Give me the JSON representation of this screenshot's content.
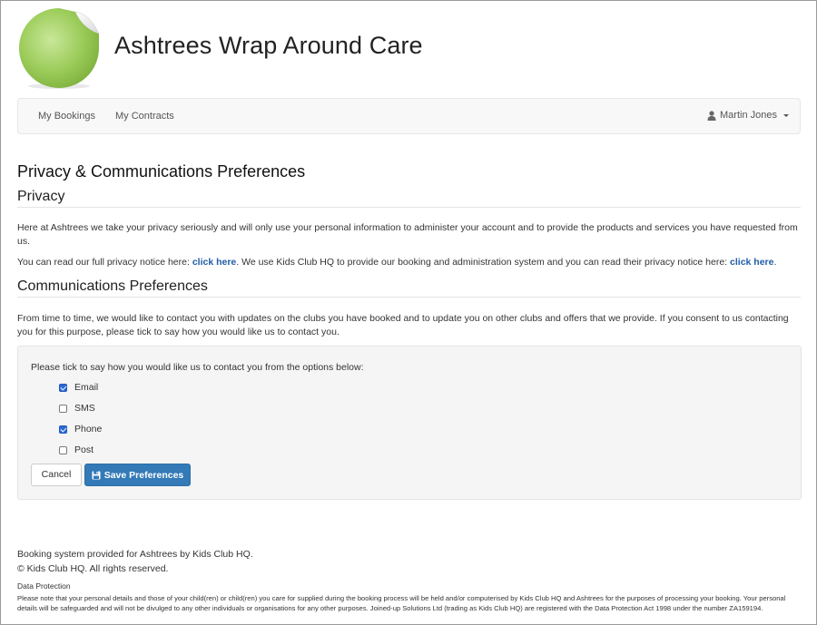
{
  "header": {
    "title": "Ashtrees Wrap Around Care",
    "logo_icon": "green-sticker-logo"
  },
  "nav": {
    "items": [
      {
        "label": "My Bookings"
      },
      {
        "label": "My Contracts"
      }
    ],
    "user": {
      "name": "Martin Jones",
      "icon": "user-icon"
    }
  },
  "page": {
    "title": "Privacy & Communications Preferences",
    "privacy": {
      "heading": "Privacy",
      "p1": "Here at Ashtrees we take your privacy seriously and will only use your personal information to administer your account and to provide the products and services you have requested from us.",
      "p2_prefix": "You can read our full privacy notice here: ",
      "p2_link1": "click here",
      "p2_middle": ". We use Kids Club HQ to provide our booking and administration system and you can read their privacy notice here: ",
      "p2_link2": "click here",
      "p2_suffix": "."
    },
    "comms": {
      "heading": "Communications Preferences",
      "p1": "From time to time, we would like to contact you with updates on the clubs you have booked and to update you on other clubs and offers that we provide. If you consent to us contacting you for this purpose, please tick to say how you would like us to contact you.",
      "prompt": "Please tick to say how you would like us to contact you from the options below:",
      "options": [
        {
          "label": "Email",
          "checked": true
        },
        {
          "label": "SMS",
          "checked": false
        },
        {
          "label": "Phone",
          "checked": true
        },
        {
          "label": "Post",
          "checked": false
        }
      ],
      "cancel_label": "Cancel",
      "save_label": "Save Preferences",
      "save_icon": "floppy-disk-icon"
    }
  },
  "footer": {
    "line1": "Booking system provided for Ashtrees by Kids Club HQ.",
    "line2": "© Kids Club HQ. All rights reserved.",
    "dp_title": "Data Protection",
    "dp_text": "Please note that your personal details and those of your child(ren) or child(ren) you care for supplied during the booking process will be held and/or computerised by Kids Club HQ and Ashtrees for the purposes of processing your booking. Your personal details will be safeguarded and will not be divulged to any other individuals or organisations for any other purposes. Joined-up Solutions Ltd (trading as Kids Club HQ) are registered with the Data Protection Act 1998 under the number ZA159194."
  },
  "colors": {
    "link": "#1f5da8",
    "primary_button": "#337ab7",
    "logo_green": "#9ccc5a"
  }
}
